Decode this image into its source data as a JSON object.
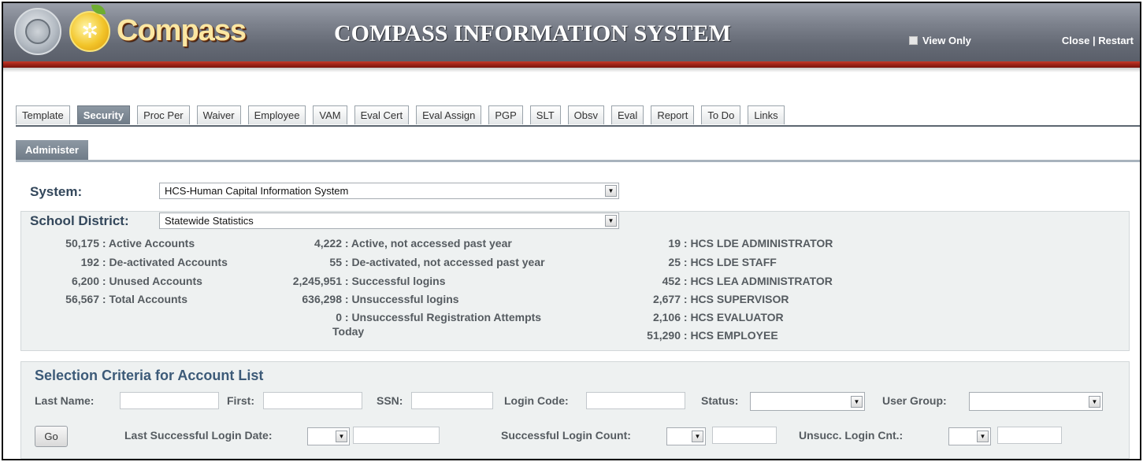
{
  "header": {
    "logo_text": "Compass",
    "app_title": "COMPASS INFORMATION SYSTEM",
    "view_only_label": "View Only",
    "close_label": "Close",
    "separator": "|",
    "restart_label": "Restart"
  },
  "tabs": [
    {
      "label": "Template",
      "active": false
    },
    {
      "label": "Security",
      "active": true
    },
    {
      "label": "Proc Per",
      "active": false
    },
    {
      "label": "Waiver",
      "active": false
    },
    {
      "label": "Employee",
      "active": false
    },
    {
      "label": "VAM",
      "active": false
    },
    {
      "label": "Eval Cert",
      "active": false
    },
    {
      "label": "Eval Assign",
      "active": false
    },
    {
      "label": "PGP",
      "active": false
    },
    {
      "label": "SLT",
      "active": false
    },
    {
      "label": "Obsv",
      "active": false
    },
    {
      "label": "Eval",
      "active": false
    },
    {
      "label": "Report",
      "active": false
    },
    {
      "label": "To Do",
      "active": false
    },
    {
      "label": "Links",
      "active": false
    }
  ],
  "subtab": {
    "label": "Administer"
  },
  "system": {
    "label": "System:",
    "value": "HCS-Human Capital Information System"
  },
  "district": {
    "label": "School District:",
    "value": "Statewide Statistics"
  },
  "stats": {
    "col1": [
      {
        "num": "50,175",
        "text": ": Active Accounts"
      },
      {
        "num": "192",
        "text": ": De-activated Accounts"
      },
      {
        "num": "6,200",
        "text": ": Unused Accounts"
      },
      {
        "num": "56,567",
        "text": ": Total Accounts"
      }
    ],
    "col2": [
      {
        "num": "4,222",
        "text": ": Active, not accessed past year"
      },
      {
        "num": "55",
        "text": ": De-activated, not accessed past year"
      },
      {
        "num": "2,245,951",
        "text": ": Successful logins"
      },
      {
        "num": "636,298",
        "text": ": Unsuccessful logins"
      },
      {
        "num": "0",
        "text": ": Unsuccessful Registration Attempts"
      }
    ],
    "col2_extra": "Today",
    "col3": [
      {
        "num": "19",
        "text": ": HCS LDE ADMINISTRATOR"
      },
      {
        "num": "25",
        "text": ": HCS LDE STAFF"
      },
      {
        "num": "452",
        "text": ": HCS LEA ADMINISTRATOR"
      },
      {
        "num": "2,677",
        "text": ": HCS SUPERVISOR"
      },
      {
        "num": "2,106",
        "text": ": HCS EVALUATOR"
      },
      {
        "num": "51,290",
        "text": ": HCS EMPLOYEE"
      }
    ]
  },
  "criteria": {
    "title": "Selection Criteria for Account List",
    "last_name_label": "Last Name:",
    "first_label": "First:",
    "ssn_label": "SSN:",
    "login_code_label": "Login Code:",
    "status_label": "Status:",
    "user_group_label": "User Group:",
    "go_label": "Go",
    "last_login_label": "Last Successful Login Date:",
    "success_count_label": "Successful Login Count:",
    "unsucc_count_label": "Unsucc. Login Cnt.:"
  },
  "icons": {
    "dropdown": "▼",
    "logo_symbol": "✲"
  },
  "colors": {
    "header_bg": "#6f7480",
    "header_stripe": "#9e2217",
    "active_tab": "#7b8793",
    "panel_bg": "#eef1f1",
    "title_blue": "#3c5a78"
  }
}
